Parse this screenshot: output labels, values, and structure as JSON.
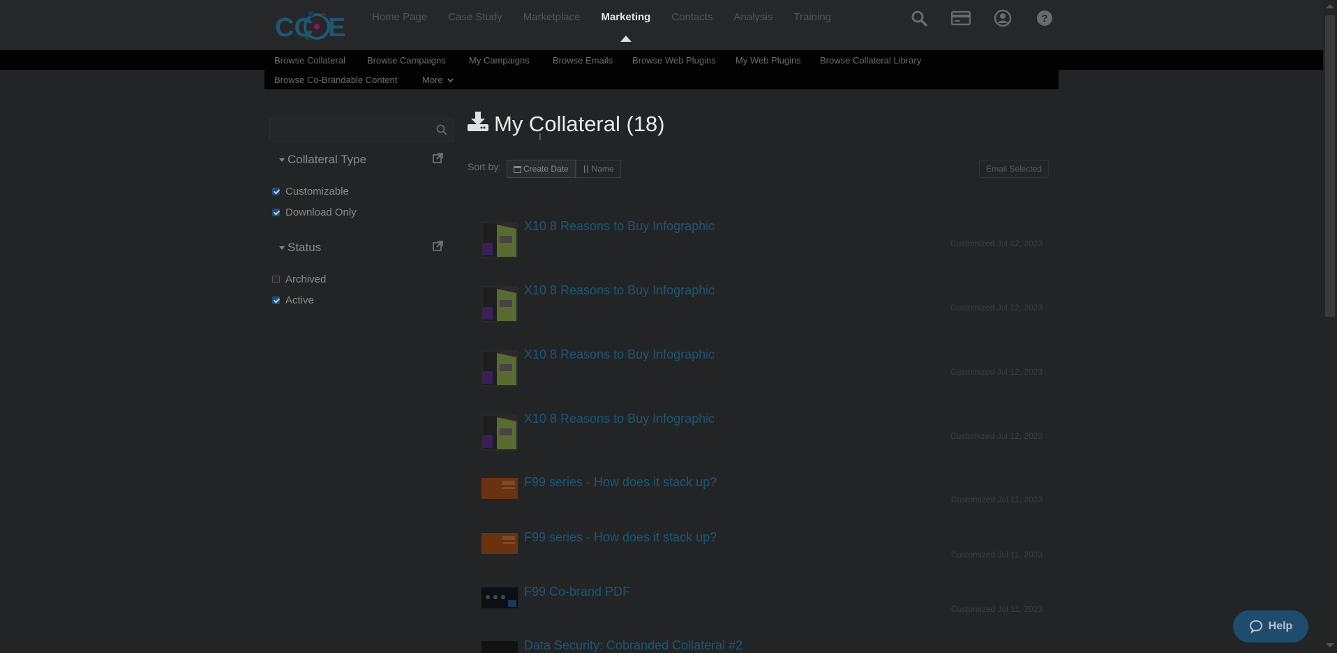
{
  "brand": {
    "logo_text": "CCOE"
  },
  "nav": {
    "items": [
      {
        "label": "Home Page"
      },
      {
        "label": "Case Study"
      },
      {
        "label": "Marketplace"
      },
      {
        "label": "Marketing"
      },
      {
        "label": "Contacts"
      },
      {
        "label": "Analysis"
      },
      {
        "label": "Training"
      }
    ],
    "active": "Marketing",
    "icons": [
      "search-icon",
      "card-icon",
      "user-icon",
      "help-circle-icon"
    ]
  },
  "subnav": {
    "items": [
      "Browse Collateral",
      "Browse Campaigns",
      "My Campaigns",
      "Browse Emails",
      "Browse Web Plugins",
      "My Web Plugins",
      "Browse Collateral Library",
      "Browse Co-Brandable Content"
    ],
    "more_label": "More"
  },
  "sidebar": {
    "search_placeholder": "",
    "facets": [
      {
        "title": "Collateral Type",
        "options": [
          {
            "label": "Customizable",
            "checked": true
          },
          {
            "label": "Download Only",
            "checked": true
          }
        ]
      },
      {
        "title": "Status",
        "options": [
          {
            "label": "Archived",
            "checked": false
          },
          {
            "label": "Active",
            "checked": true
          }
        ]
      }
    ]
  },
  "main": {
    "title": "My Collateral (18)",
    "sort_label": "Sort by:",
    "sort_options": [
      {
        "label": "Create Date",
        "active": true
      },
      {
        "label": "Name",
        "active": false
      }
    ],
    "email_selected": "Email Selected",
    "items": [
      {
        "title": "X10 8 Reasons to Buy Infographic",
        "date": "Customized Jul 12, 2023",
        "thumb": "infographic"
      },
      {
        "title": "X10 8 Reasons to Buy Infographic",
        "date": "Customized Jul 12, 2023",
        "thumb": "infographic"
      },
      {
        "title": "X10 8 Reasons to Buy Infographic",
        "date": "Customized Jul 12, 2023",
        "thumb": "infographic"
      },
      {
        "title": "X10 8 Reasons to Buy Infographic",
        "date": "Customized Jul 12, 2023",
        "thumb": "infographic"
      },
      {
        "title": "F99 series - How does it stack up?",
        "date": "Customized Jul 11, 2023",
        "thumb": "orange"
      },
      {
        "title": "F99 series - How does it stack up?",
        "date": "Customized Jul 11, 2023",
        "thumb": "orange"
      },
      {
        "title": "F99 Co-brand PDF",
        "date": "Customized Jul 11, 2023",
        "thumb": "dark"
      },
      {
        "title": "Data Security: Cobranded Collateral #2",
        "date": "",
        "thumb": "dark"
      }
    ]
  },
  "help": {
    "label": "Help"
  }
}
